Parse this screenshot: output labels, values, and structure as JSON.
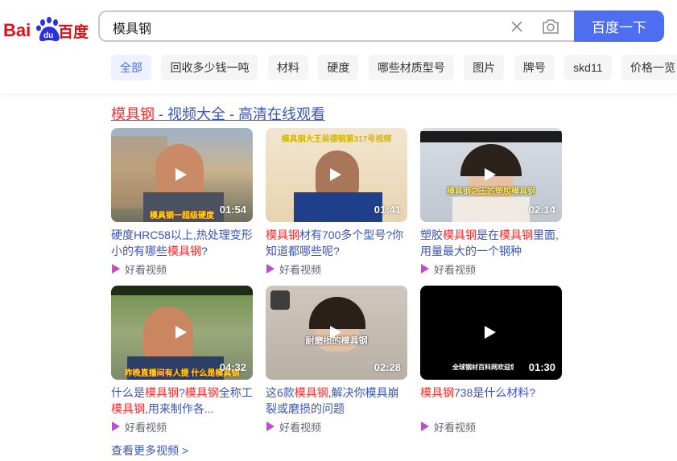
{
  "logo": {
    "text_bai": "Bai",
    "text_du": "du",
    "text_baidu": "百度"
  },
  "search": {
    "query": "模具钢",
    "button_label": "百度一下"
  },
  "tabs": [
    "全部",
    "回收多少钱一吨",
    "材料",
    "硬度",
    "哪些材质型号",
    "图片",
    "牌号",
    "skd11",
    "价格一览"
  ],
  "section": {
    "title_hl": "模具钢",
    "title_rest": " - 视频大全 - 高清在线观看"
  },
  "videos": [
    {
      "duration": "01:54",
      "overlay": "模具钢一超级硬度",
      "title_parts": [
        "硬度HRC58以上,热处理变形小的有哪些",
        "模具钢",
        "?"
      ],
      "source": "好看视频"
    },
    {
      "duration": "01:41",
      "overlay": "模具钢大王吴德钢第317号视频",
      "title_parts": [
        "",
        "模具钢",
        "材有700多个型号?你知道都哪些呢?"
      ],
      "source": "好看视频"
    },
    {
      "duration": "02:14",
      "overlay": "模具钢之王的塑胶模具钢",
      "title_parts": [
        "塑胶",
        "模具钢",
        "是在",
        "模具钢",
        "里面,用量最大的一个钢种"
      ],
      "source": "好看视频"
    },
    {
      "duration": "04:32",
      "overlay": "昨晚直播间有人提 什么是模具钢",
      "title_parts": [
        "什么是",
        "模具钢",
        "?",
        "模具钢",
        "全称工",
        "模具钢",
        ",用来制作各..."
      ],
      "source": "好看视频"
    },
    {
      "duration": "02:28",
      "overlay": "耐磨损的模具钢",
      "title_parts": [
        "这6款",
        "模具钢",
        ",解决你模具崩裂或磨损的问题"
      ],
      "source": "好看视频"
    },
    {
      "duration": "01:30",
      "overlay": "全球钢材百科网欢迎您",
      "title_parts": [
        "",
        "模具钢",
        "738是什么材料?"
      ],
      "source": "好看视频"
    }
  ],
  "more_link": "查看更多视频 >",
  "colors": {
    "accent": "#4e6ef2",
    "highlight": "#f73131",
    "link": "#3b55b8"
  }
}
